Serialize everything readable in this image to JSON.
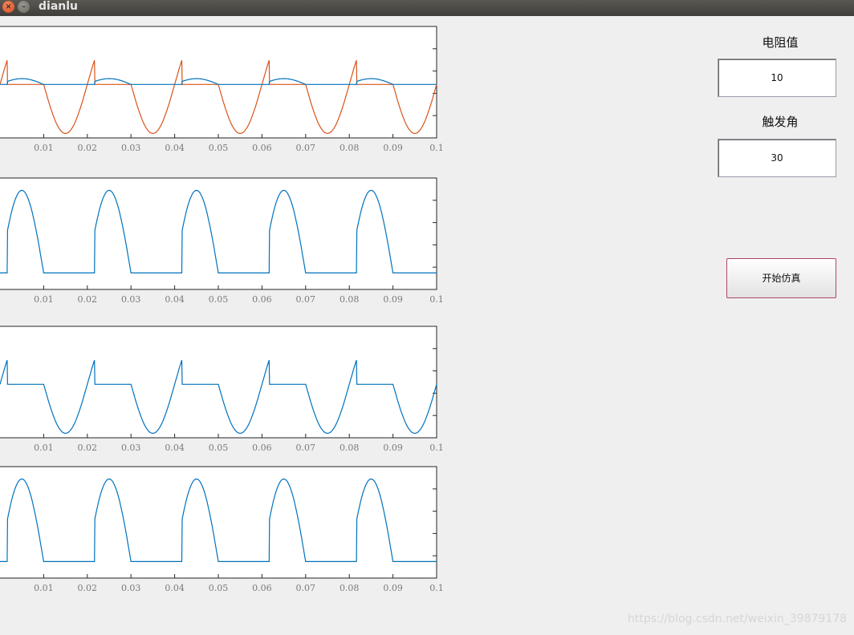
{
  "window": {
    "title": "dianlu",
    "close_glyph": "×",
    "min_glyph": "–"
  },
  "colors": {
    "series_blue": "#0072bd",
    "series_orange": "#d95319",
    "axes_border": "#262626",
    "tick_label": "#7a7a7a"
  },
  "controls": {
    "resistance_label": "电阻值",
    "resistance_value": "10",
    "angle_label": "触发角",
    "angle_value": "30",
    "start_button": "开始仿真"
  },
  "watermark": "https://blog.csdn.net/weixin_39879178",
  "chart_data": [
    {
      "type": "line",
      "x_ticks": [
        "0.01",
        "0.02",
        "0.03",
        "0.04",
        "0.05",
        "0.06",
        "0.07",
        "0.08",
        "0.09",
        "0.1"
      ],
      "xlim": [
        0,
        0.1
      ],
      "ylim": [
        -1.2,
        1.3
      ],
      "series": [
        {
          "color": "#d95319",
          "kind": "thyristor_voltage",
          "alpha_deg": 30
        },
        {
          "color": "#0072bd",
          "kind": "load_voltage_small",
          "alpha_deg": 30
        }
      ]
    },
    {
      "type": "line",
      "x_ticks": [
        "0.01",
        "0.02",
        "0.03",
        "0.04",
        "0.05",
        "0.06",
        "0.07",
        "0.08",
        "0.09",
        "0.1"
      ],
      "xlim": [
        0,
        0.1
      ],
      "ylim": [
        -0.2,
        1.15
      ],
      "series": [
        {
          "color": "#0072bd",
          "kind": "load_voltage",
          "alpha_deg": 30
        }
      ]
    },
    {
      "type": "line",
      "x_ticks": [
        "0.01",
        "0.02",
        "0.03",
        "0.04",
        "0.05",
        "0.06",
        "0.07",
        "0.08",
        "0.09",
        "0.1"
      ],
      "xlim": [
        0,
        0.1
      ],
      "ylim": [
        -1.2,
        1.3
      ],
      "series": [
        {
          "color": "#0072bd",
          "kind": "thyristor_voltage_only",
          "alpha_deg": 30
        }
      ]
    },
    {
      "type": "line",
      "x_ticks": [
        "0.01",
        "0.02",
        "0.03",
        "0.04",
        "0.05",
        "0.06",
        "0.07",
        "0.08",
        "0.09",
        "0.1"
      ],
      "xlim": [
        0,
        0.1
      ],
      "ylim": [
        -0.2,
        1.15
      ],
      "series": [
        {
          "color": "#0072bd",
          "kind": "load_current",
          "alpha_deg": 30
        }
      ]
    }
  ]
}
